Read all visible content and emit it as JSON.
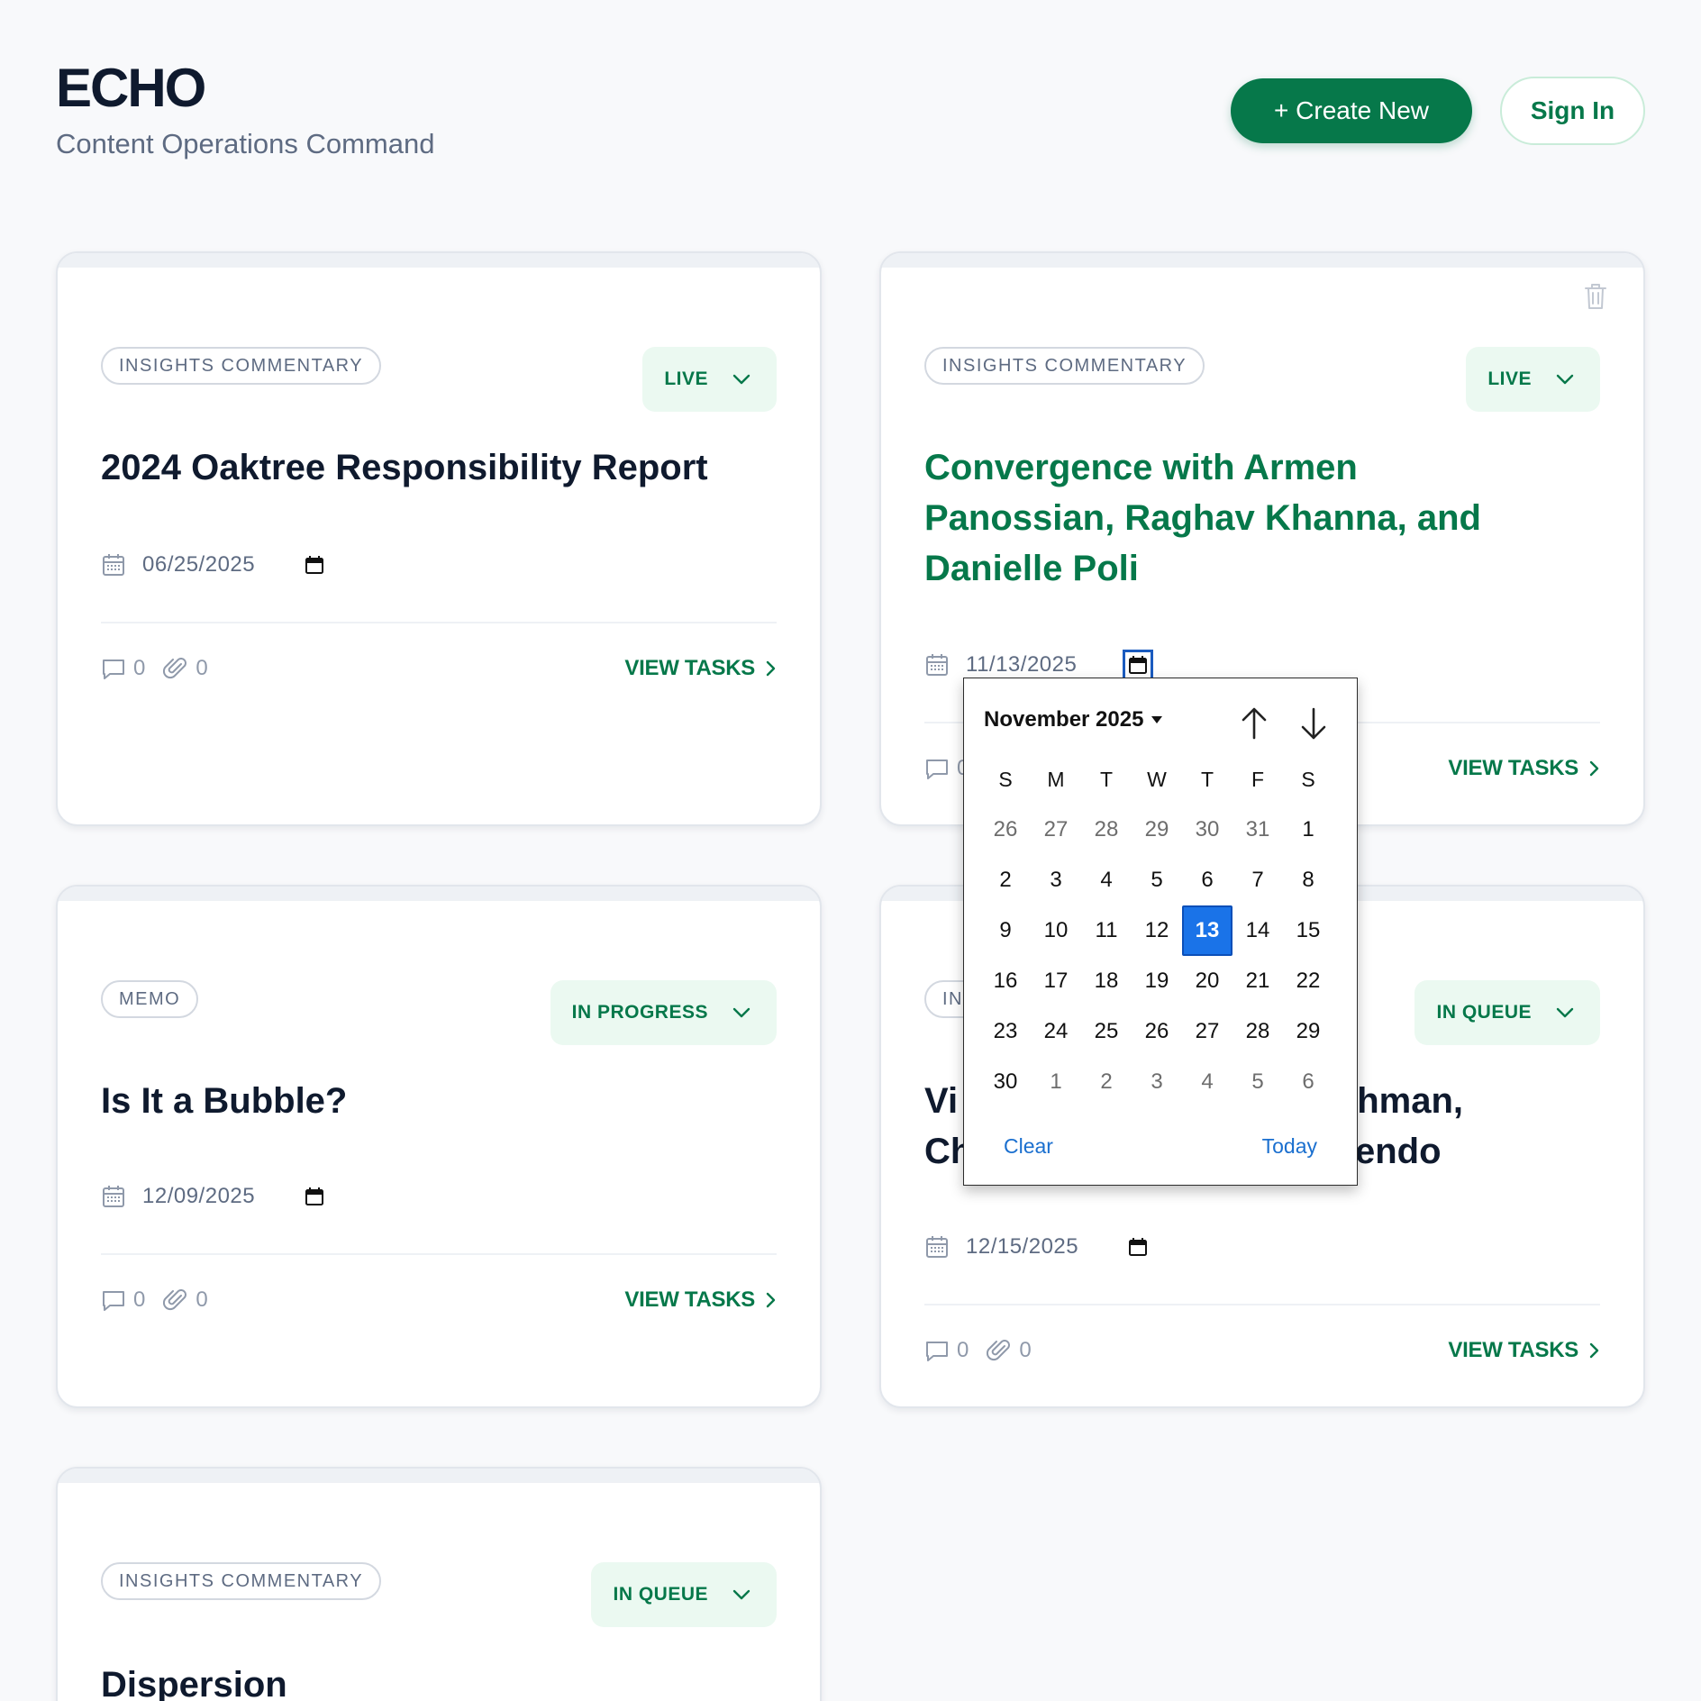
{
  "header": {
    "title": "ECHO",
    "subtitle": "Content Operations Command",
    "create_label": "+ Create New",
    "signin_label": "Sign In"
  },
  "cards": [
    {
      "type": "INSIGHTS COMMENTARY",
      "status": "LIVE",
      "title": "2024 Oaktree Responsibility Report",
      "date": "06/25/2025",
      "comments": "0",
      "attachments": "0",
      "view_tasks": "VIEW TASKS"
    },
    {
      "type": "INSIGHTS COMMENTARY",
      "status": "LIVE",
      "title": "Convergence with Armen Panossian, Raghav Khanna, and Danielle Poli",
      "date": "11/13/2025",
      "comments": "0",
      "view_tasks": "VIEW TASKS"
    },
    {
      "type": "MEMO",
      "status": "IN PROGRESS",
      "title": "Is It a Bubble?",
      "date": "12/09/2025",
      "comments": "0",
      "attachments": "0",
      "view_tasks": "VIEW TASKS"
    },
    {
      "type": "INS",
      "status": "IN QUEUE",
      "title_line1_start": "Vi",
      "title_line1_end": "chman,",
      "title_line2_start": "Ch",
      "title_line2_end": "endo",
      "date": "12/15/2025",
      "comments": "0",
      "attachments": "0",
      "view_tasks": "VIEW TASKS"
    },
    {
      "type": "INSIGHTS COMMENTARY",
      "status": "IN QUEUE",
      "title": "Dispersion"
    }
  ],
  "calendar": {
    "month_label": "November 2025",
    "weekdays": [
      "S",
      "M",
      "T",
      "W",
      "T",
      "F",
      "S"
    ],
    "weeks": [
      [
        "26",
        "27",
        "28",
        "29",
        "30",
        "31",
        "1"
      ],
      [
        "2",
        "3",
        "4",
        "5",
        "6",
        "7",
        "8"
      ],
      [
        "9",
        "10",
        "11",
        "12",
        "13",
        "14",
        "15"
      ],
      [
        "16",
        "17",
        "18",
        "19",
        "20",
        "21",
        "22"
      ],
      [
        "23",
        "24",
        "25",
        "26",
        "27",
        "28",
        "29"
      ],
      [
        "30",
        "1",
        "2",
        "3",
        "4",
        "5",
        "6"
      ]
    ],
    "selected": "13",
    "clear_label": "Clear",
    "today_label": "Today"
  },
  "colors": {
    "accent": "#06784a",
    "status_bg": "#ebf9f1",
    "selected_day": "#1a73e8",
    "link_blue": "#1a6fcf"
  }
}
